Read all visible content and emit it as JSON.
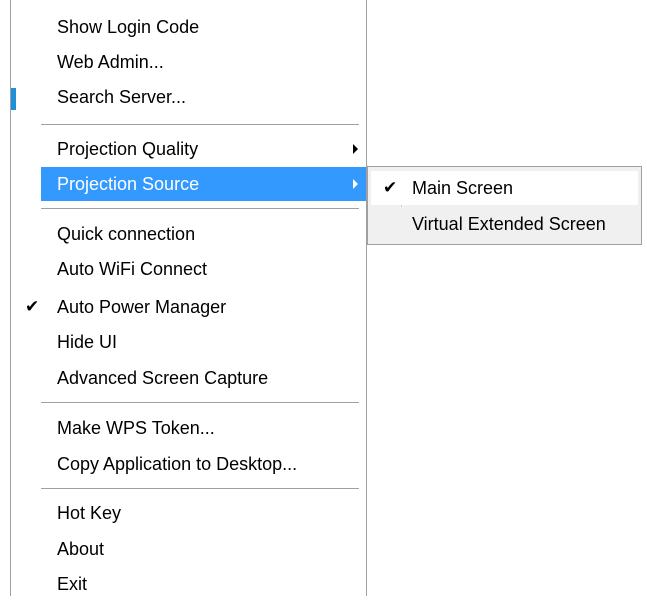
{
  "menu": {
    "items": [
      {
        "label": "Show Login Code"
      },
      {
        "label": "Web Admin..."
      },
      {
        "label": "Search Server..."
      },
      {
        "label": "Projection Quality"
      },
      {
        "label": "Projection Source"
      },
      {
        "label": "Quick connection"
      },
      {
        "label": "Auto WiFi Connect"
      },
      {
        "label": "Auto Power Manager",
        "check": "✔"
      },
      {
        "label": "Hide UI"
      },
      {
        "label": "Advanced Screen Capture"
      },
      {
        "label": "Make WPS Token..."
      },
      {
        "label": "Copy Application to Desktop..."
      },
      {
        "label": "Hot Key"
      },
      {
        "label": "About"
      },
      {
        "label": "Exit"
      }
    ]
  },
  "submenu": {
    "items": [
      {
        "label": "Main Screen",
        "check": "✔"
      },
      {
        "label": "Virtual Extended Screen"
      }
    ]
  },
  "colors": {
    "highlight": "#3399ff",
    "accent": "#1e90d8"
  },
  "icons": {
    "submenu_arrow": "chevron-right-icon",
    "checkmark": "check-icon"
  }
}
